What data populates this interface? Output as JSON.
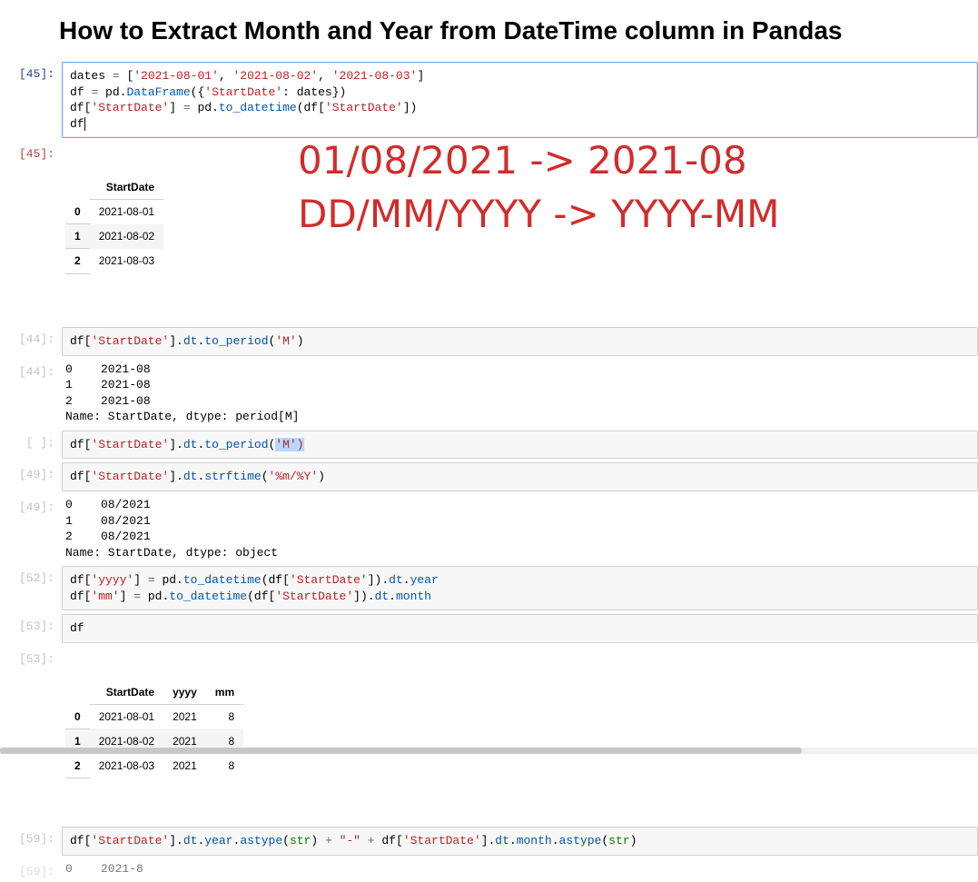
{
  "title": "How to Extract Month and Year from DateTime column in Pandas",
  "overlay_line1": "01/08/2021 -> 2021-08",
  "overlay_line2": "DD/MM/YYYY -> YYYY-MM",
  "cells": {
    "c45in": {
      "prompt": "[45]:",
      "code_tokens": [
        [
          "n",
          "dates "
        ],
        [
          "eq",
          "="
        ],
        [
          "n",
          " "
        ],
        [
          "p",
          "["
        ],
        [
          "s",
          "'2021-08-01'"
        ],
        [
          "p",
          ", "
        ],
        [
          "s",
          "'2021-08-02'"
        ],
        [
          "p",
          ", "
        ],
        [
          "s",
          "'2021-08-03'"
        ],
        [
          "p",
          "]"
        ],
        [
          "br",
          ""
        ],
        [
          "n",
          "df "
        ],
        [
          "eq",
          "="
        ],
        [
          "n",
          " pd"
        ],
        [
          "p",
          "."
        ],
        [
          "DataFrame",
          "DataFrame"
        ],
        [
          "p",
          "({"
        ],
        [
          "s",
          "'StartDate'"
        ],
        [
          "p",
          ": dates})"
        ],
        [
          "br",
          ""
        ],
        [
          "n",
          "df["
        ],
        [
          "s",
          "'StartDate'"
        ],
        [
          "p",
          "] "
        ],
        [
          "eq",
          "="
        ],
        [
          "n",
          " pd"
        ],
        [
          "p",
          "."
        ],
        [
          "fn",
          "to_datetime"
        ],
        [
          "p",
          "(df["
        ],
        [
          "s",
          "'StartDate'"
        ],
        [
          "p",
          "])"
        ],
        [
          "br",
          ""
        ],
        [
          "n",
          "df"
        ],
        [
          "cur",
          ""
        ]
      ]
    },
    "c45out": {
      "prompt": "[45]:",
      "table": {
        "columns": [
          "",
          "StartDate"
        ],
        "rows": [
          [
            "0",
            "2021-08-01"
          ],
          [
            "1",
            "2021-08-02"
          ],
          [
            "2",
            "2021-08-03"
          ]
        ]
      }
    },
    "c44in": {
      "prompt": "[44]:",
      "code_tokens": [
        [
          "n",
          "df["
        ],
        [
          "s",
          "'StartDate'"
        ],
        [
          "p",
          "]"
        ],
        [
          "p",
          "."
        ],
        [
          "dt",
          "dt"
        ],
        [
          "p",
          "."
        ],
        [
          "fn",
          "to_period"
        ],
        [
          "p",
          "("
        ],
        [
          "s",
          "'M'"
        ],
        [
          "p",
          ")"
        ]
      ]
    },
    "c44out": {
      "prompt": "[44]:",
      "text": "0    2021-08\n1    2021-08\n2    2021-08\nName: StartDate, dtype: period[M]"
    },
    "cempty": {
      "prompt": "[ ]:",
      "code_tokens": [
        [
          "n",
          "df["
        ],
        [
          "s",
          "'StartDate'"
        ],
        [
          "p",
          "]"
        ],
        [
          "p",
          "."
        ],
        [
          "dt",
          "dt"
        ],
        [
          "p",
          "."
        ],
        [
          "fn",
          "to_period"
        ],
        [
          "p",
          "("
        ],
        [
          "ssel",
          "'M')"
        ]
      ]
    },
    "c49in": {
      "prompt": "[49]:",
      "code_tokens": [
        [
          "n",
          "df["
        ],
        [
          "s",
          "'StartDate'"
        ],
        [
          "p",
          "]"
        ],
        [
          "p",
          "."
        ],
        [
          "dt",
          "dt"
        ],
        [
          "p",
          "."
        ],
        [
          "fn",
          "strftime"
        ],
        [
          "p",
          "("
        ],
        [
          "s",
          "'%m/%Y'"
        ],
        [
          "p",
          ")"
        ]
      ]
    },
    "c49out": {
      "prompt": "[49]:",
      "text": "0    08/2021\n1    08/2021\n2    08/2021\nName: StartDate, dtype: object"
    },
    "c52in": {
      "prompt": "[52]:",
      "code_tokens": [
        [
          "n",
          "df["
        ],
        [
          "s",
          "'yyyy'"
        ],
        [
          "p",
          "] "
        ],
        [
          "eq",
          "="
        ],
        [
          "n",
          " pd"
        ],
        [
          "p",
          "."
        ],
        [
          "fn",
          "to_datetime"
        ],
        [
          "p",
          "(df["
        ],
        [
          "s",
          "'StartDate'"
        ],
        [
          "p",
          "])."
        ],
        [
          "dt",
          "dt"
        ],
        [
          "p",
          "."
        ],
        [
          "fn",
          "year"
        ],
        [
          "br",
          ""
        ],
        [
          "n",
          "df["
        ],
        [
          "s",
          "'mm'"
        ],
        [
          "p",
          "] "
        ],
        [
          "eq",
          "="
        ],
        [
          "n",
          " pd"
        ],
        [
          "p",
          "."
        ],
        [
          "fn",
          "to_datetime"
        ],
        [
          "p",
          "(df["
        ],
        [
          "s",
          "'StartDate'"
        ],
        [
          "p",
          "])."
        ],
        [
          "dt",
          "dt"
        ],
        [
          "p",
          "."
        ],
        [
          "fn",
          "month"
        ]
      ]
    },
    "c53in": {
      "prompt": "[53]:",
      "code_tokens": [
        [
          "n",
          "df"
        ]
      ]
    },
    "c53out": {
      "prompt": "[53]:",
      "table": {
        "columns": [
          "",
          "StartDate",
          "yyyy",
          "mm"
        ],
        "rows": [
          [
            "0",
            "2021-08-01",
            "2021",
            "8"
          ],
          [
            "1",
            "2021-08-02",
            "2021",
            "8"
          ],
          [
            "2",
            "2021-08-03",
            "2021",
            "8"
          ]
        ]
      }
    },
    "c59in": {
      "prompt": "[59]:",
      "code_tokens": [
        [
          "n",
          "df["
        ],
        [
          "s",
          "'StartDate'"
        ],
        [
          "p",
          "]"
        ],
        [
          "p",
          "."
        ],
        [
          "dt",
          "dt"
        ],
        [
          "p",
          "."
        ],
        [
          "fn",
          "year"
        ],
        [
          "p",
          "."
        ],
        [
          "fn",
          "astype"
        ],
        [
          "p",
          "("
        ],
        [
          "bn",
          "str"
        ],
        [
          "p",
          ") "
        ],
        [
          "o",
          "+"
        ],
        [
          "n",
          " "
        ],
        [
          "s",
          "\"-\""
        ],
        [
          "n",
          " "
        ],
        [
          "o",
          "+"
        ],
        [
          "n",
          " df["
        ],
        [
          "s",
          "'StartDate'"
        ],
        [
          "p",
          "]"
        ],
        [
          "p",
          "."
        ],
        [
          "dt",
          "dt"
        ],
        [
          "p",
          "."
        ],
        [
          "fn",
          "month"
        ],
        [
          "p",
          "."
        ],
        [
          "fn",
          "astype"
        ],
        [
          "p",
          "("
        ],
        [
          "bn",
          "str"
        ],
        [
          "p",
          ")"
        ]
      ]
    },
    "c59out": {
      "prompt": "[59]:",
      "text": "0    2021-8"
    }
  }
}
